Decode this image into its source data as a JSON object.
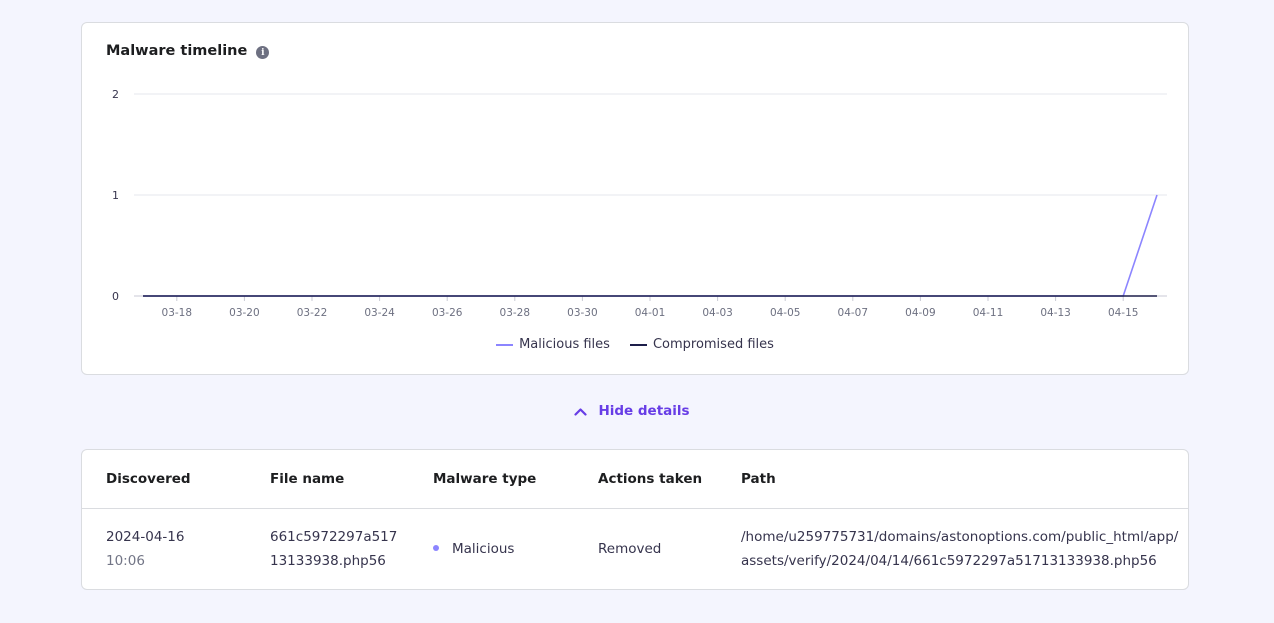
{
  "chart_card": {
    "title": "Malware timeline",
    "info_icon": "info-icon"
  },
  "chart_data": {
    "type": "line",
    "title": "Malware timeline",
    "x": [
      "03-17",
      "03-18",
      "03-19",
      "03-20",
      "03-21",
      "03-22",
      "03-23",
      "03-24",
      "03-25",
      "03-26",
      "03-27",
      "03-28",
      "03-29",
      "03-30",
      "03-31",
      "04-01",
      "04-02",
      "04-03",
      "04-04",
      "04-05",
      "04-06",
      "04-07",
      "04-08",
      "04-09",
      "04-10",
      "04-11",
      "04-12",
      "04-13",
      "04-14",
      "04-15",
      "04-16"
    ],
    "tick_labels": [
      "03-18",
      "03-20",
      "03-22",
      "03-24",
      "03-26",
      "03-28",
      "03-30",
      "04-01",
      "04-03",
      "04-05",
      "04-07",
      "04-09",
      "04-11",
      "04-13",
      "04-15"
    ],
    "y_ticks": [
      0,
      1,
      2
    ],
    "ylim": [
      0,
      2
    ],
    "grid": true,
    "legend_position": "bottom",
    "series": [
      {
        "name": "Malicious files",
        "color": "#8c85ff",
        "values": [
          0,
          0,
          0,
          0,
          0,
          0,
          0,
          0,
          0,
          0,
          0,
          0,
          0,
          0,
          0,
          0,
          0,
          0,
          0,
          0,
          0,
          0,
          0,
          0,
          0,
          0,
          0,
          0,
          0,
          0,
          1
        ]
      },
      {
        "name": "Compromised files",
        "color": "#1d1e4a",
        "values": [
          0,
          0,
          0,
          0,
          0,
          0,
          0,
          0,
          0,
          0,
          0,
          0,
          0,
          0,
          0,
          0,
          0,
          0,
          0,
          0,
          0,
          0,
          0,
          0,
          0,
          0,
          0,
          0,
          0,
          0,
          0
        ]
      }
    ]
  },
  "toggle": {
    "label": "Hide details",
    "icon": "chevron-up-icon"
  },
  "table": {
    "headers": [
      "Discovered",
      "File name",
      "Malware type",
      "Actions taken",
      "Path"
    ],
    "rows": [
      {
        "date": "2024-04-16",
        "time": "10:06",
        "file_line1": "661c5972297a517",
        "file_line2": "13133938.php56",
        "type": "Malicious",
        "action": "Removed",
        "path_line1": "/home/u259775731/domains/astonoptions.com/public_html/app/",
        "path_line2": "assets/verify/2024/04/14/661c5972297a51713133938.php56"
      }
    ]
  }
}
